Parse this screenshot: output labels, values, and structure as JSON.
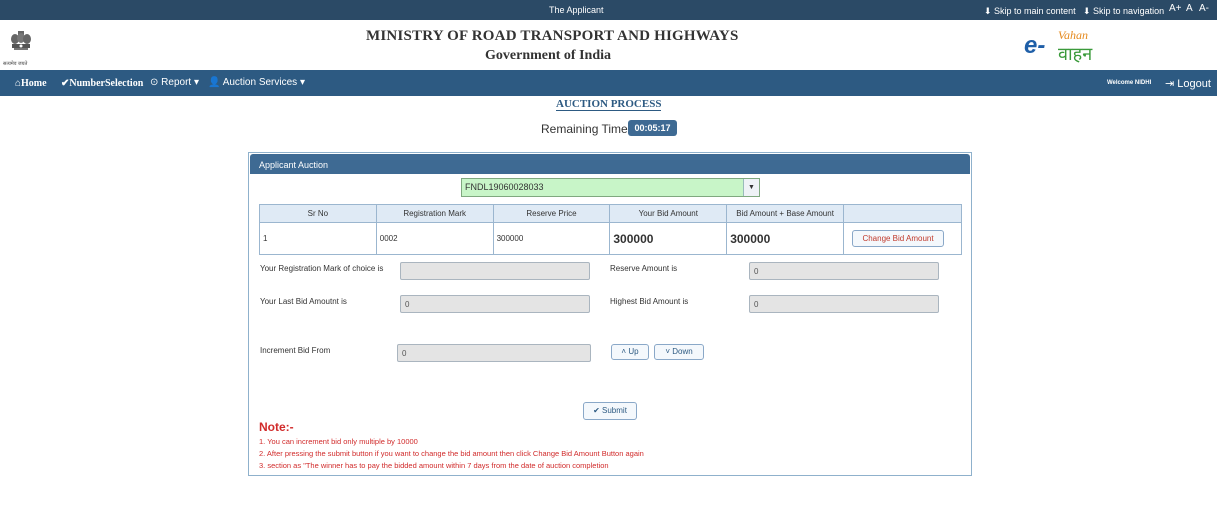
{
  "topbar": {
    "title": "The Applicant",
    "skip_main": "⬇ Skip to main content",
    "skip_nav": "⬇ Skip to navigation",
    "font_larger": "A+",
    "font_normal": "A",
    "font_smaller": "A-"
  },
  "header": {
    "emblem_text": "सत्यमेव जयते",
    "ministry": "MINISTRY OF ROAD TRANSPORT AND HIGHWAYS",
    "government": "Government of India",
    "logo_e": "e-",
    "logo_vahan_top": "Vahan",
    "logo_vahan_bottom": "वाहन"
  },
  "nav": {
    "home": "Home",
    "number_selection": "NumberSelection",
    "report": "Report",
    "auction_services": "Auction Services",
    "welcome": "Welcome NIDHI",
    "logout": "Logout"
  },
  "page": {
    "process_title": "AUCTION PROCESS",
    "remaining_label": "Remaining Time",
    "remaining_time": "00:05:17"
  },
  "panel": {
    "title": "Applicant Auction",
    "selected_application": "FNDL19060028033",
    "columns": [
      "Sr No",
      "Registration Mark",
      "Reserve Price",
      "Your Bid Amount",
      "Bid Amount + Base Amount",
      ""
    ],
    "rows": [
      {
        "sr_no": "1",
        "registration_mark": "0002",
        "reserve_price": "300000",
        "your_bid": "300000",
        "bid_plus_base": "300000",
        "action": "Change Bid Amount"
      }
    ],
    "fields": {
      "reg_mark_label": "Your Registration Mark of choice is",
      "reg_mark_value": "",
      "reserve_label": "Reserve Amount is",
      "reserve_value": "0",
      "last_bid_label": "Your Last Bid Amoutnt is",
      "last_bid_value": "0",
      "highest_label": "Highest Bid Amount is",
      "highest_value": "0",
      "increment_label": "Increment Bid From",
      "increment_value": "0"
    },
    "up_label": "Up",
    "down_label": "Down",
    "submit_label": "Submit",
    "note_title": "Note:-",
    "notes": [
      "1. You can increment bid only multiple by 10000",
      "2. After pressing the submit button if you want to change the bid amount then click Change Bid Amount Button again",
      "3. section as \"The winner has to pay the bidded amount within 7 days from the date of auction completion"
    ]
  }
}
